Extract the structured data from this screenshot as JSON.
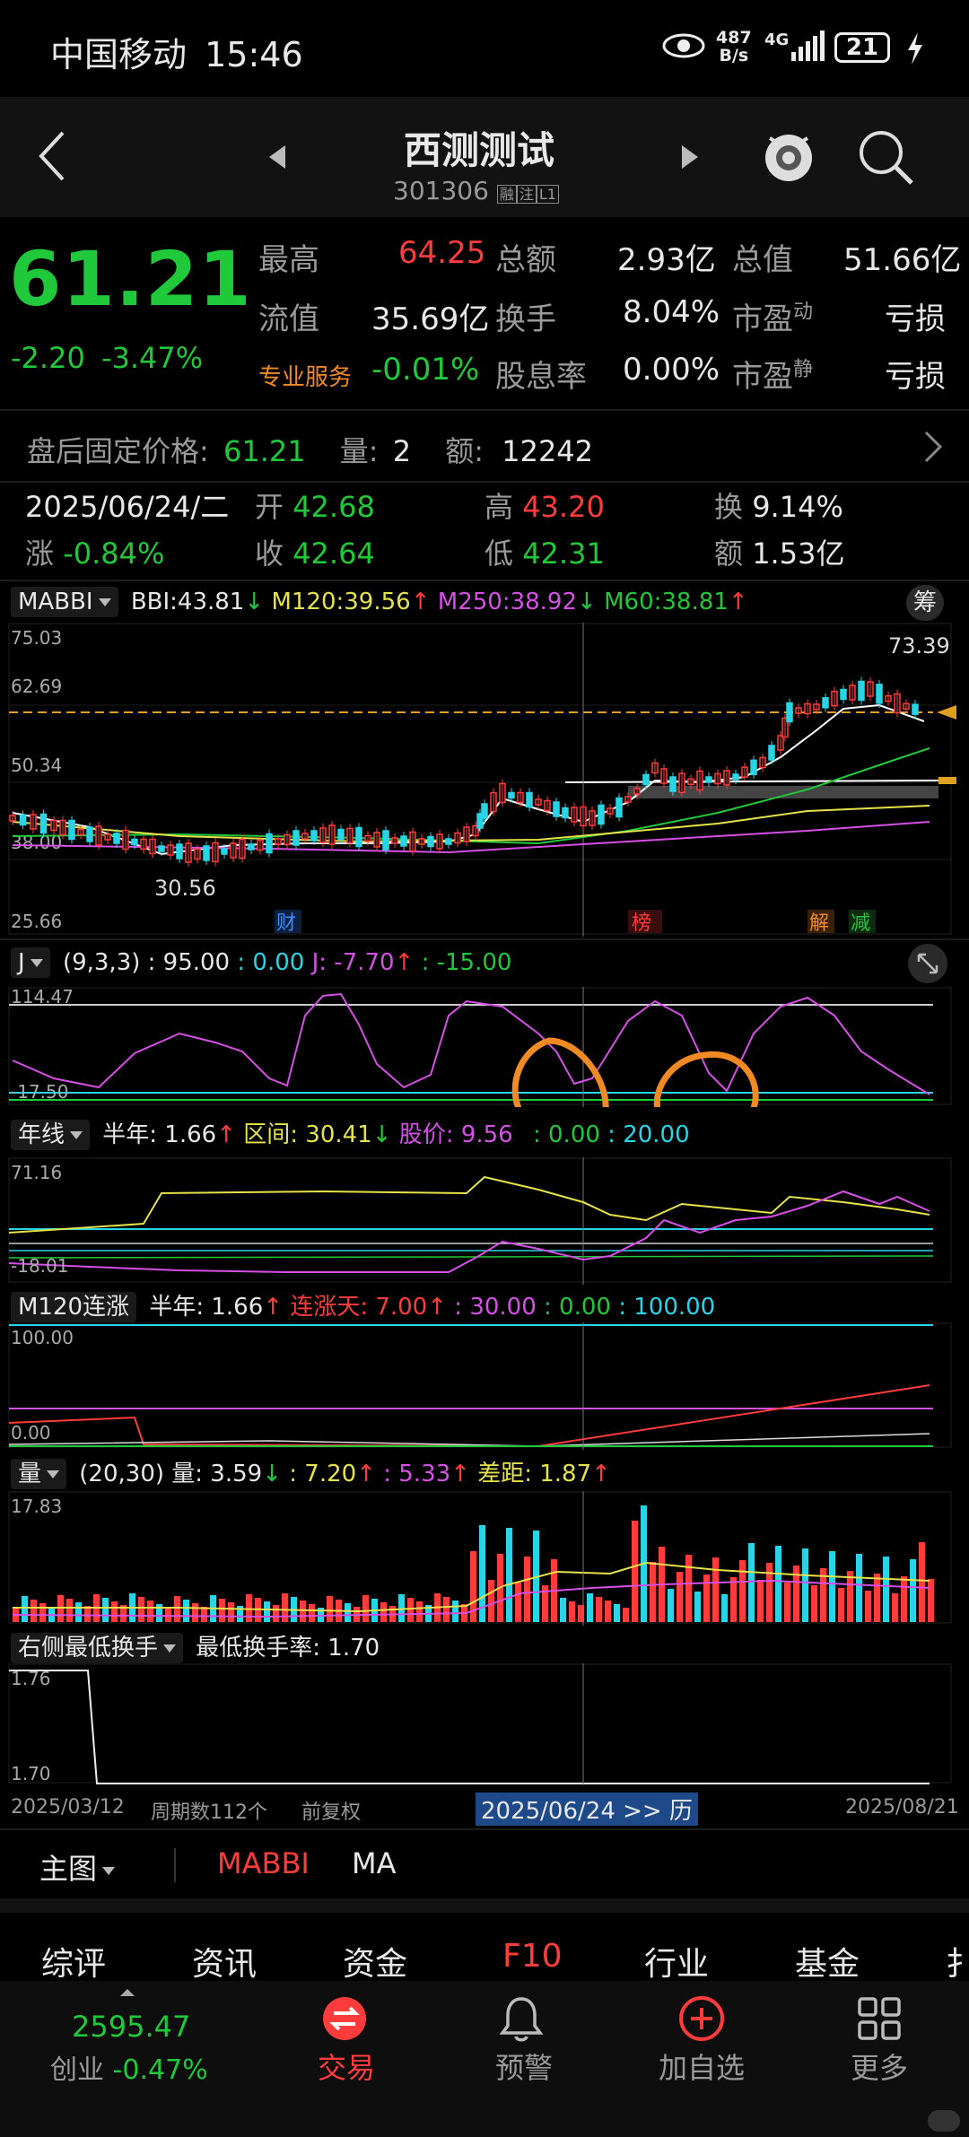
{
  "status_bar": {
    "carrier": "中国移动",
    "time": "15:46",
    "net_speed_top": "487",
    "net_speed_bot": "B/s",
    "signal": "4G",
    "battery": "21"
  },
  "nav": {
    "stock_name": "西测测试",
    "code": "301306",
    "tag1": "融",
    "tag2": "注",
    "tag3": "L1"
  },
  "quote": {
    "price": "61.21",
    "change": "-2.20",
    "change_pct": "-3.47%",
    "high_label": "最高",
    "high": "64.25",
    "amount_label": "总额",
    "amount": "2.93亿",
    "mcap_label": "总值",
    "mcap": "51.66亿",
    "float_label": "流值",
    "float_val": "35.69亿",
    "turnover_label": "换手",
    "turnover": "8.04%",
    "pe_dyn_label": "市盈",
    "pe_dyn_sup": "动",
    "pe_dyn": "亏损",
    "service_label": "专业服务",
    "service_val": "-0.01%",
    "div_label": "股息率",
    "div": "0.00%",
    "pe_static_label": "市盈",
    "pe_static_sup": "静",
    "pe_static": "亏损"
  },
  "after_hours": {
    "label": "盘后固定价格:",
    "price": "61.21",
    "vol_label": "量:",
    "vol": "2",
    "amt_label": "额:",
    "amt": "12242"
  },
  "day_info": {
    "date": "2025/06/24/二",
    "open_label": "开",
    "open": "42.68",
    "high_label": "高",
    "high": "43.20",
    "turn_label": "换",
    "turn": "9.14%",
    "chg_label": "涨",
    "chg": "-0.84%",
    "close_label": "收",
    "close": "42.64",
    "low_label": "低",
    "low": "42.31",
    "amt_label": "额",
    "amt": "1.53亿"
  },
  "main_chart": {
    "indicator": "MABBI",
    "bbi": "BBI:43.81",
    "m120": "M120:39.56",
    "m250": "M250:38.92",
    "m60": "M60:38.81",
    "side_btn": "筹",
    "y_labels": [
      "75.03",
      "62.69",
      "50.34",
      "38.00",
      "25.66"
    ],
    "max_label": "73.39",
    "min_label": "30.56",
    "markers": [
      "财",
      "榜",
      "解",
      "减"
    ]
  },
  "j_panel": {
    "name": "J",
    "params": "(9,3,3) : 95.00",
    "v1": ": 0.00",
    "jval": "J: -7.70",
    "v2": ": -15.00",
    "y_top": "114.47",
    "y_bot": "-17.50"
  },
  "year_panel": {
    "name": "年线",
    "half": "半年: 1.66",
    "range": "区间: 30.41",
    "price": "股价: 9.56",
    "v1": ": 0.00",
    "v2": ": 20.00",
    "y_top": "71.16",
    "y_bot": "-18.01"
  },
  "m120_panel": {
    "name": "M120连涨",
    "half": "半年: 1.66",
    "days": "连涨天: 7.00",
    "v1": ": 30.00",
    "v2": ": 0.00",
    "v3": ": 100.00",
    "y_top": "100.00",
    "y_bot": "0.00"
  },
  "vol_panel": {
    "name": "量",
    "params": "(20,30) 量: 3.59",
    "v1": ": 7.20",
    "v2": ": 5.33",
    "gap": "差距: 1.87",
    "y_top": "17.83"
  },
  "turn_panel": {
    "name": "右侧最低换手",
    "label": "最低换手率: 1.70",
    "y_top": "1.76",
    "y_bot": "1.70"
  },
  "axis": {
    "start": "2025/03/12",
    "periods": "周期数112个",
    "adj": "前复权",
    "cursor": "2025/06/24 >> 历",
    "end": "2025/08/21"
  },
  "chart_tabs": {
    "main": "主图",
    "t1": "MABBI",
    "t2": "MA"
  },
  "bottom_tabs": [
    "综评",
    "资讯",
    "资金",
    "F10",
    "行业",
    "基金",
    "扌"
  ],
  "index": {
    "value": "2595.47",
    "name": "创业",
    "pct": "-0.47%"
  },
  "nav_bottom": [
    "交易",
    "预警",
    "加自选",
    "更多"
  ],
  "colors": {
    "up": "#ff3b3b",
    "down": "#1fc93a",
    "bbi": "#ffffff",
    "m120": "#e6e24a",
    "m250": "#d64fe6",
    "m60": "#1fc93a",
    "cyan": "#28d5e6",
    "orange_annotation": "#f08a24"
  }
}
